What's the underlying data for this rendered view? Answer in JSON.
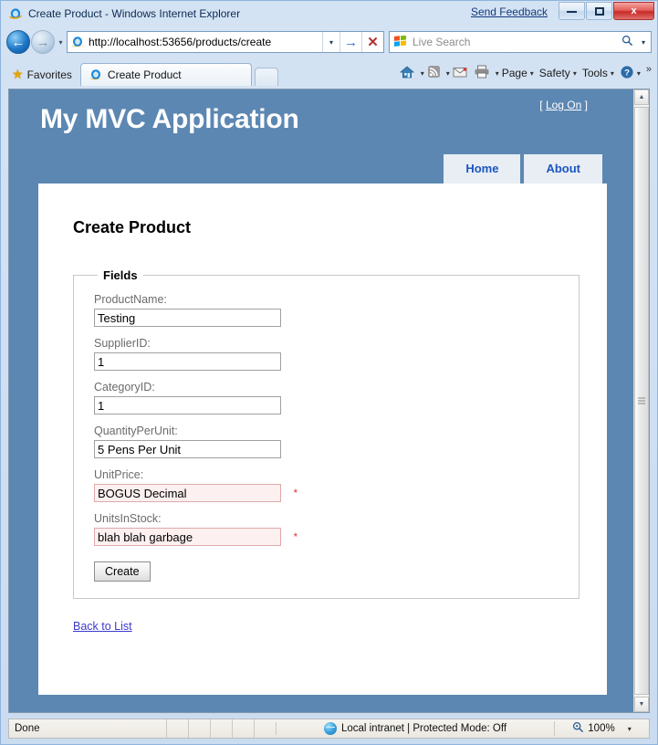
{
  "window": {
    "title": "Create Product - Windows Internet Explorer",
    "send_feedback": "Send Feedback",
    "minimize_label": "Minimize",
    "maximize_label": "Maximize",
    "close_label": "x"
  },
  "browser": {
    "address_url": "http://localhost:53656/products/create",
    "search_placeholder": "Live Search",
    "favorites_label": "Favorites",
    "tab_title": "Create Product",
    "command_items": [
      {
        "label": "Page",
        "caret": "▾"
      },
      {
        "label": "Safety",
        "caret": "▾"
      },
      {
        "label": "Tools",
        "caret": "▾"
      }
    ],
    "overflow_chevron": "»",
    "back_glyph": "←",
    "forward_glyph": "→",
    "history_caret": "▾",
    "go_glyph": "→",
    "stop_glyph": "✕",
    "search_glyph": "⌕",
    "icons": {
      "home": "home-icon",
      "feeds": "rss-icon",
      "mail": "mail-icon",
      "print": "print-icon",
      "help": "help-icon",
      "star": "★"
    }
  },
  "page": {
    "site_title": "My MVC Application",
    "logon_open_bracket": "[",
    "logon_label": "Log On",
    "logon_close_bracket": "]",
    "nav": [
      {
        "label": "Home"
      },
      {
        "label": "About"
      }
    ],
    "heading": "Create Product",
    "fieldset_legend": "Fields",
    "fields": [
      {
        "label": "ProductName:",
        "value": "Testing",
        "error": false
      },
      {
        "label": "SupplierID:",
        "value": "1",
        "error": false
      },
      {
        "label": "CategoryID:",
        "value": "1",
        "error": false
      },
      {
        "label": "QuantityPerUnit:",
        "value": "5 Pens Per Unit",
        "error": false
      },
      {
        "label": "UnitPrice:",
        "value": "BOGUS Decimal",
        "error": true
      },
      {
        "label": "UnitsInStock:",
        "value": "blah blah garbage",
        "error": true
      }
    ],
    "error_marker": "*",
    "submit_label": "Create",
    "back_link": "Back to List",
    "colors": {
      "header_blue": "#5C87B2",
      "nav_tab_bg": "#E8EEF4",
      "nav_tab_text": "#1C55C0",
      "link_blue": "#3B3BCF",
      "error_bg": "#FDF0F0",
      "error_border": "#E0A8A8",
      "error_text": "#E03A3A",
      "label_gray": "#6B6B6B"
    }
  },
  "status": {
    "message": "Done",
    "zone": "Local intranet | Protected Mode: Off",
    "zoom": "100%",
    "zoom_caret": "▾"
  },
  "scrollbar": {
    "up_glyph": "▲",
    "down_glyph": "▼"
  }
}
